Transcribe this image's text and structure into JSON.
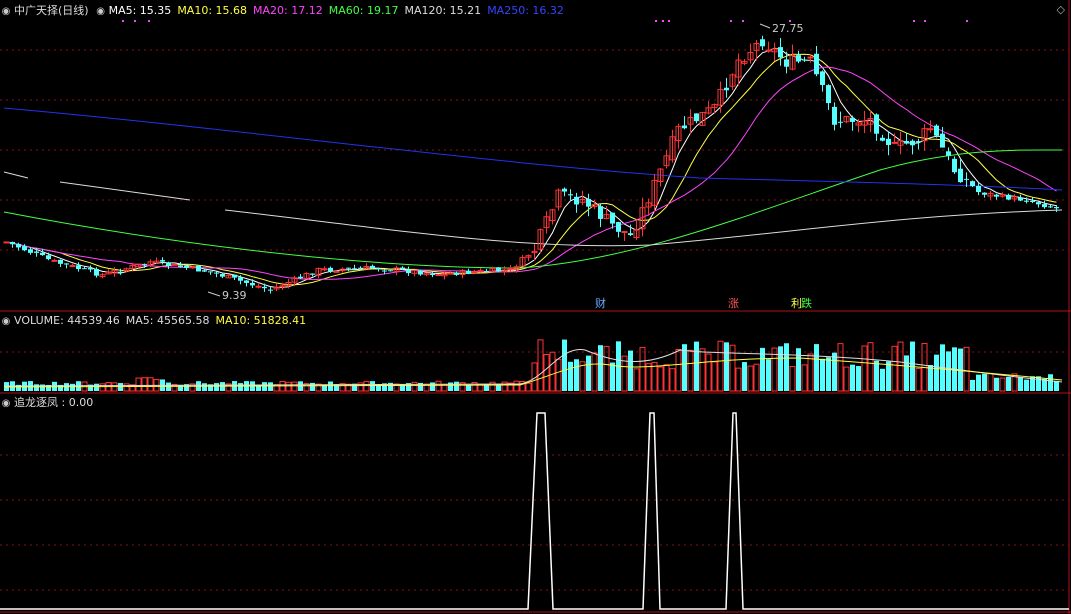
{
  "main": {
    "title": "中广天择(日线)",
    "ma": [
      {
        "label": "MA5: 15.35",
        "color": "#ffffff"
      },
      {
        "label": "MA10: 15.68",
        "color": "#ffff44"
      },
      {
        "label": "MA20: 17.12",
        "color": "#ff44ff"
      },
      {
        "label": "MA60: 19.17",
        "color": "#44ff44"
      },
      {
        "label": "MA120: 15.21",
        "color": "#dddddd"
      },
      {
        "label": "MA250: 16.32",
        "color": "#3344ff"
      }
    ],
    "high_label": "27.75",
    "low_label": "9.39",
    "events": [
      {
        "text": "财",
        "color": "#66aaff"
      },
      {
        "text": "涨",
        "color": "#ff5555"
      },
      {
        "text": "利",
        "color": "#ffff44"
      },
      {
        "text": "跌",
        "color": "#44ff44"
      }
    ]
  },
  "volume": {
    "ma": [
      {
        "label": "VOLUME: 44539.46",
        "color": "#dddddd"
      },
      {
        "label": "MA5: 45565.58",
        "color": "#dddddd"
      },
      {
        "label": "MA10: 51828.41",
        "color": "#ffff44"
      }
    ]
  },
  "indicator": {
    "label": "追龙逐凤 : 0.00"
  },
  "colors": {
    "up": "#ff3333",
    "down": "#55ffff",
    "grid": "#8a1010"
  }
}
